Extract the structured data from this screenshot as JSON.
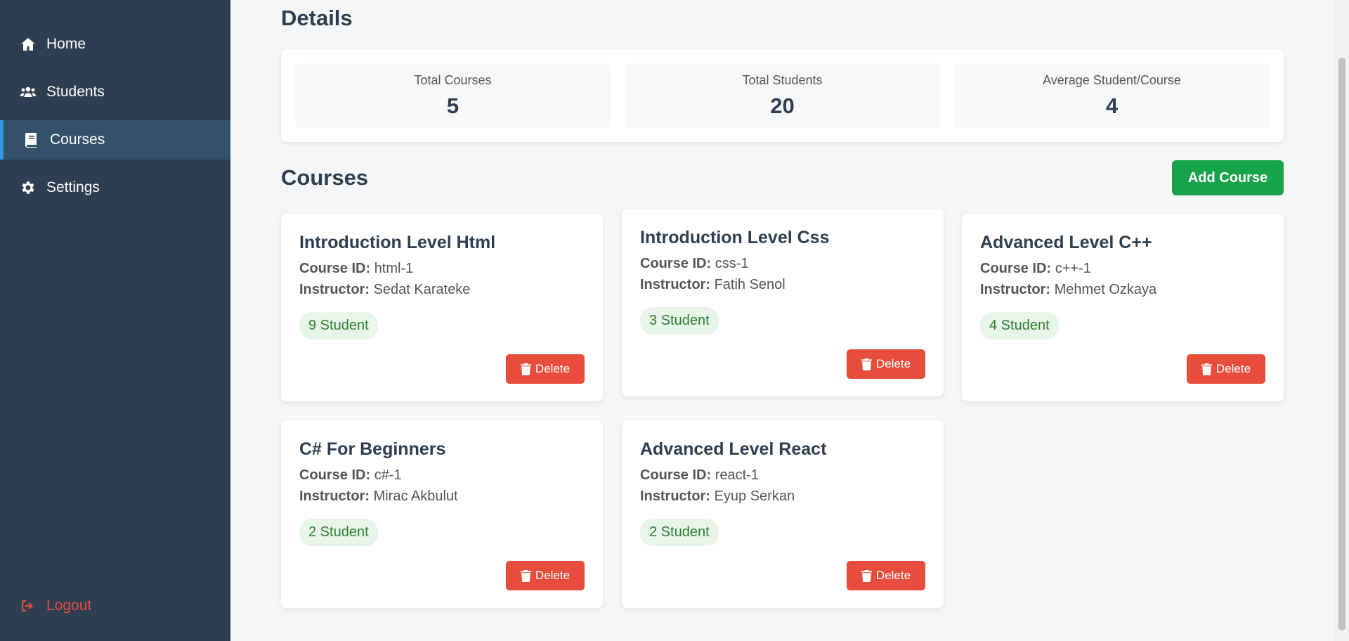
{
  "sidebar": {
    "items": [
      {
        "label": "Home",
        "icon": "home-icon"
      },
      {
        "label": "Students",
        "icon": "users-icon"
      },
      {
        "label": "Courses",
        "icon": "book-icon",
        "active": true
      },
      {
        "label": "Settings",
        "icon": "gear-icon"
      }
    ],
    "logout_label": "Logout"
  },
  "details": {
    "title": "Details",
    "stats": [
      {
        "label": "Total Courses",
        "value": "5"
      },
      {
        "label": "Total Students",
        "value": "20"
      },
      {
        "label": "Average Student/Course",
        "value": "4"
      }
    ]
  },
  "courses": {
    "title": "Courses",
    "add_label": "Add Course",
    "id_label": "Course ID:",
    "instructor_label": "Instructor:",
    "delete_label": "Delete",
    "items": [
      {
        "title": "Introduction Level Html",
        "id": "html-1",
        "instructor": "Sedat Karateke",
        "students": "9 Student"
      },
      {
        "title": "Introduction Level Css",
        "id": "css-1",
        "instructor": "Fatih Senol",
        "students": "3 Student"
      },
      {
        "title": "Advanced Level C++",
        "id": "c++-1",
        "instructor": "Mehmet Ozkaya",
        "students": "4 Student"
      },
      {
        "title": "C# For Beginners",
        "id": "c#-1",
        "instructor": "Mirac Akbulut",
        "students": "2 Student"
      },
      {
        "title": "Advanced Level React",
        "id": "react-1",
        "instructor": "Eyup Serkan",
        "students": "2 Student"
      }
    ]
  },
  "colors": {
    "sidebar_bg": "#2c3e50",
    "active_accent": "#3498db",
    "add_button": "#16a34a",
    "delete_button": "#e74c3c",
    "logout": "#e74c3c",
    "badge_bg": "#e8f5e9",
    "badge_text": "#2e7d32"
  }
}
